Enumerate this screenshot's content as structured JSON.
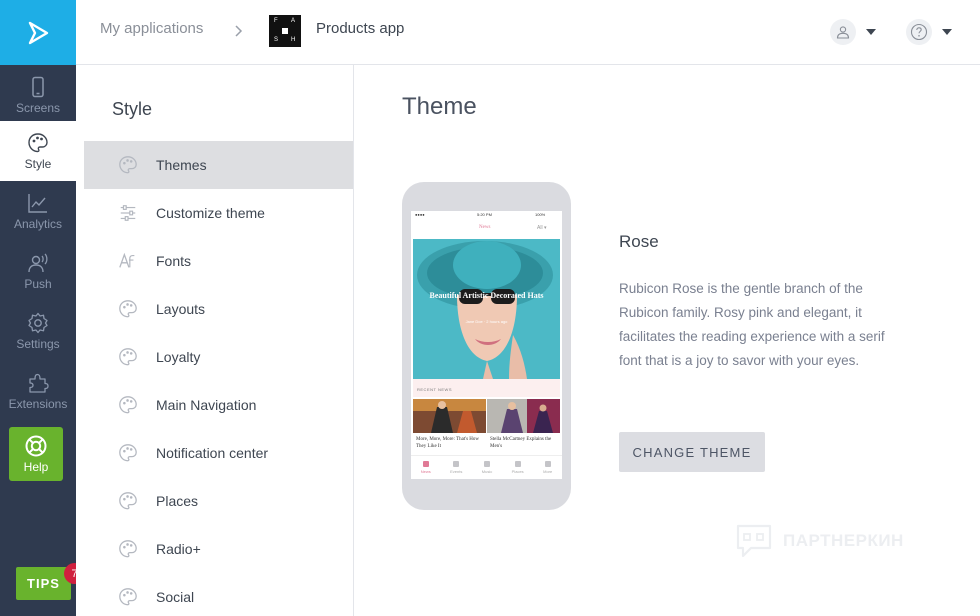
{
  "rail": {
    "items": [
      {
        "label": "Screens",
        "icon": "phone-icon"
      },
      {
        "label": "Style",
        "icon": "palette-icon"
      },
      {
        "label": "Analytics",
        "icon": "chart-icon"
      },
      {
        "label": "Push",
        "icon": "push-icon"
      },
      {
        "label": "Settings",
        "icon": "gear-icon"
      },
      {
        "label": "Extensions",
        "icon": "puzzle-icon"
      }
    ],
    "help_label": "Help",
    "tips_label": "TIPS",
    "tips_count": "7"
  },
  "header": {
    "breadcrumb_root": "My applications",
    "app_name": "Products app",
    "app_thumb_letters": [
      "F",
      "A",
      "S",
      "H"
    ]
  },
  "submenu": {
    "title": "Style",
    "items": [
      {
        "label": "Themes",
        "icon": "palette-icon",
        "active": true
      },
      {
        "label": "Customize theme",
        "icon": "sliders-icon"
      },
      {
        "label": "Fonts",
        "icon": "font-icon"
      },
      {
        "label": "Layouts",
        "icon": "palette-icon"
      },
      {
        "label": "Loyalty",
        "icon": "palette-icon"
      },
      {
        "label": "Main Navigation",
        "icon": "palette-icon"
      },
      {
        "label": "Notification center",
        "icon": "palette-icon"
      },
      {
        "label": "Places",
        "icon": "palette-icon"
      },
      {
        "label": "Radio+",
        "icon": "palette-icon"
      },
      {
        "label": "Social",
        "icon": "palette-icon"
      }
    ]
  },
  "main": {
    "title": "Theme",
    "theme_name": "Rose",
    "theme_description": "Rubicon Rose is the gentle branch of the Rubicon family. Rosy pink and elegant, it facilitates the reading experience with a serif font that is a joy to savor with your eyes.",
    "change_button": "CHANGE THEME"
  },
  "preview": {
    "status_time": "5:20 PM",
    "status_battery": "100%",
    "nav_title": "News",
    "nav_filter": "All ▾",
    "hero_title": "Beautiful Artistic Decorated Hats",
    "hero_meta": "Jane Doe  ·  2 hours ago",
    "section_label": "RECENT NEWS",
    "card1_caption": "More, More, More: That's How They Like It",
    "card2_caption": "Stella McCartney Explains the Men's",
    "tabs": [
      "News",
      "Events",
      "Music",
      "Places",
      "More"
    ]
  },
  "watermark": "ПАРТНЕРКИН",
  "colors": {
    "rail_bg": "#2f3a4f",
    "logo_bg": "#1eaee6",
    "help_green": "#69b32d",
    "badge_red": "#d0203e",
    "active_row": "#dddee1",
    "rose_accent": "#e07a96"
  }
}
